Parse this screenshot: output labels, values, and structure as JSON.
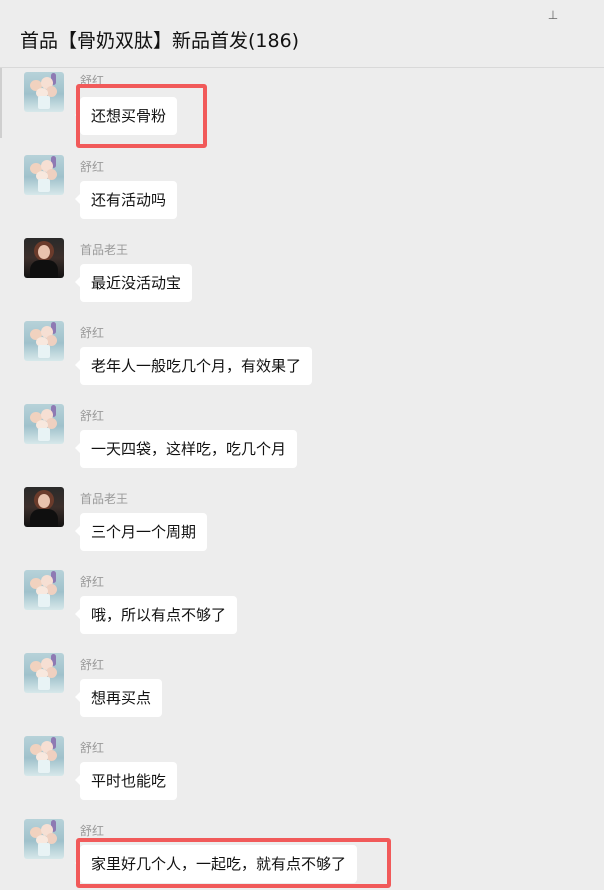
{
  "header": {
    "title": "首品【骨奶双肽】新品首发(186)",
    "pin_icon": "pin-icon"
  },
  "messages": [
    {
      "sender": "舒红",
      "text": "还想买骨粉",
      "avatar": "flower-avatar"
    },
    {
      "sender": "舒红",
      "text": "还有活动吗",
      "avatar": "flower-avatar"
    },
    {
      "sender": "首品老王",
      "text": "最近没活动宝",
      "avatar": "person-avatar"
    },
    {
      "sender": "舒红",
      "text": "老年人一般吃几个月，有效果了",
      "avatar": "flower-avatar"
    },
    {
      "sender": "舒红",
      "text": "一天四袋，这样吃，吃几个月",
      "avatar": "flower-avatar"
    },
    {
      "sender": "首品老王",
      "text": "三个月一个周期",
      "avatar": "person-avatar"
    },
    {
      "sender": "舒红",
      "text": "哦，所以有点不够了",
      "avatar": "flower-avatar"
    },
    {
      "sender": "舒红",
      "text": "想再买点",
      "avatar": "flower-avatar"
    },
    {
      "sender": "舒红",
      "text": "平时也能吃",
      "avatar": "flower-avatar"
    },
    {
      "sender": "舒红",
      "text": "家里好几个人，一起吃，就有点不够了",
      "avatar": "flower-avatar"
    }
  ],
  "colors": {
    "background": "#ededed",
    "bubble": "#ffffff",
    "highlight": "#f15a5a",
    "name_text": "#9a9a9a"
  }
}
